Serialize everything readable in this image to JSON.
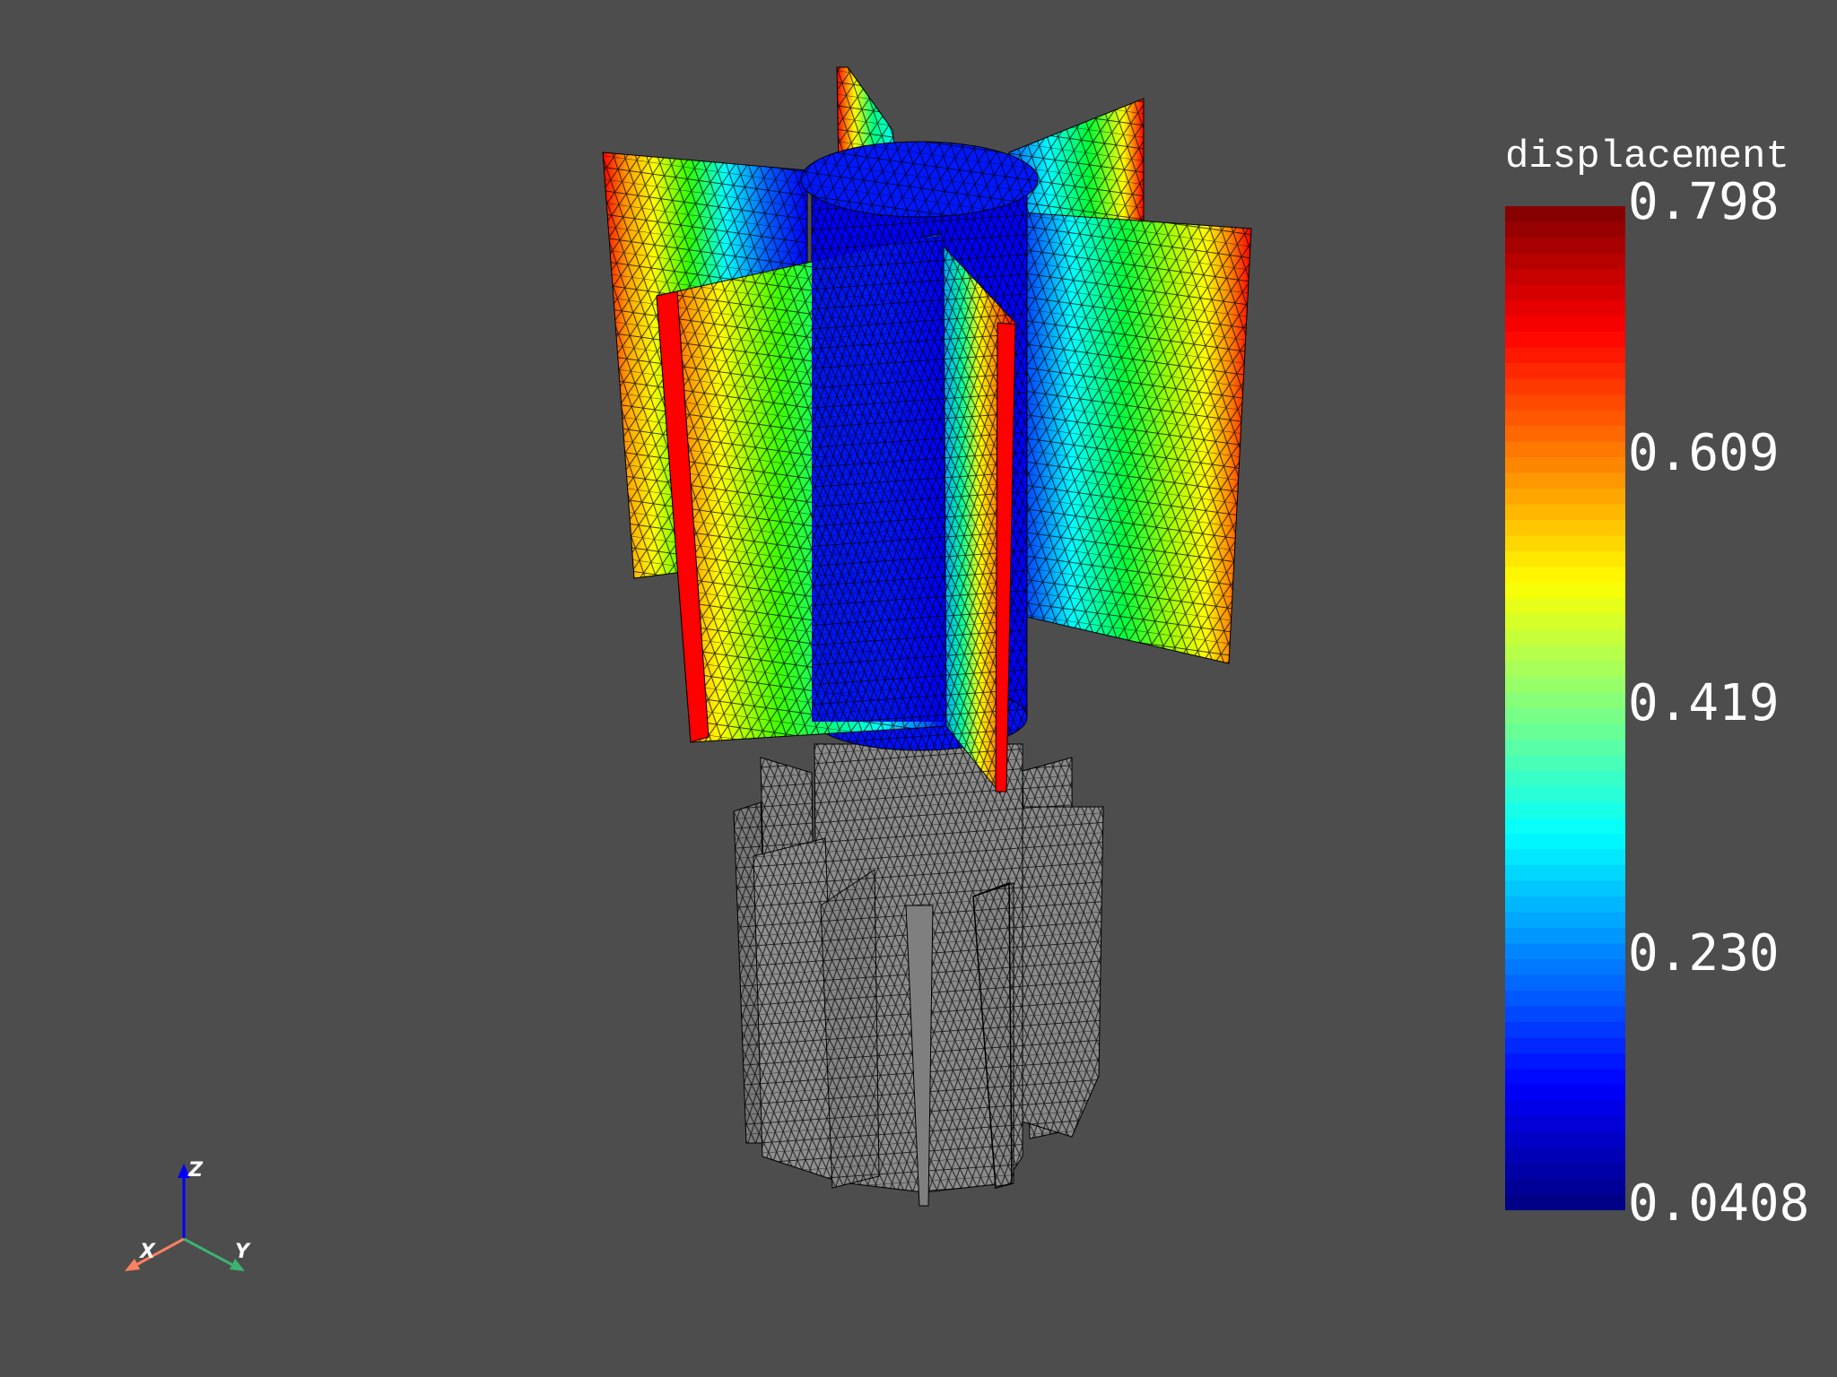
{
  "scalar_bar": {
    "title": "displacement",
    "labels": [
      "0.798",
      "0.609",
      "0.419",
      "0.230",
      "0.0408"
    ],
    "range": [
      0.0408,
      0.798
    ],
    "colormap": "jet",
    "colors": [
      "#0000ff",
      "#0080ff",
      "#00ffff",
      "#00ff80",
      "#00ff00",
      "#80ff00",
      "#ffff00",
      "#ff8000",
      "#ff0000"
    ],
    "n_bands": 64
  },
  "axes_widget": {
    "x_label": "X",
    "y_label": "Y",
    "z_label": "Z",
    "x_color": "#ff8062",
    "y_color": "#3cb371",
    "z_color": "#0000ff"
  },
  "scene": {
    "background": "#4d4d4d",
    "mesh_color": "#808080",
    "edge_color": "#000000"
  }
}
